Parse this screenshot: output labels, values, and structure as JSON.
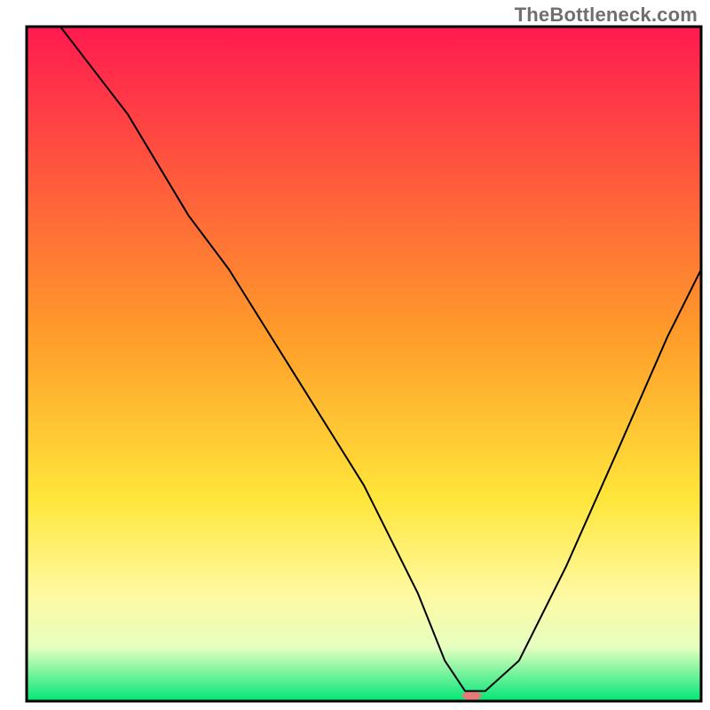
{
  "watermark": "TheBottleneck.com",
  "chart_data": {
    "type": "line",
    "title": "",
    "xlabel": "",
    "ylabel": "",
    "xlim": [
      0,
      100
    ],
    "ylim": [
      0,
      100
    ],
    "background_gradient": {
      "stops": [
        {
          "offset": 0,
          "color": "#ff1a50"
        },
        {
          "offset": 0.45,
          "color": "#ff9a2a"
        },
        {
          "offset": 0.7,
          "color": "#ffe63a"
        },
        {
          "offset": 0.84,
          "color": "#fff9a0"
        },
        {
          "offset": 0.92,
          "color": "#e6ffc0"
        },
        {
          "offset": 1.0,
          "color": "#00e676"
        }
      ]
    },
    "series": [
      {
        "name": "bottleneck-curve",
        "color": "#000000",
        "stroke_width": 2,
        "x": [
          5,
          15,
          24,
          30,
          40,
          50,
          58,
          62,
          65,
          68,
          73,
          80,
          88,
          95,
          100
        ],
        "y": [
          100,
          87,
          72,
          64,
          48,
          32,
          16,
          6,
          1.5,
          1.5,
          6,
          20,
          38,
          54,
          64
        ]
      }
    ],
    "marker": {
      "name": "optimal-marker",
      "x": 66,
      "y": 0.8,
      "rx": 11,
      "ry": 5,
      "color": "#e47a7a"
    },
    "frame": {
      "color": "#000000",
      "stroke_width": 3
    }
  }
}
